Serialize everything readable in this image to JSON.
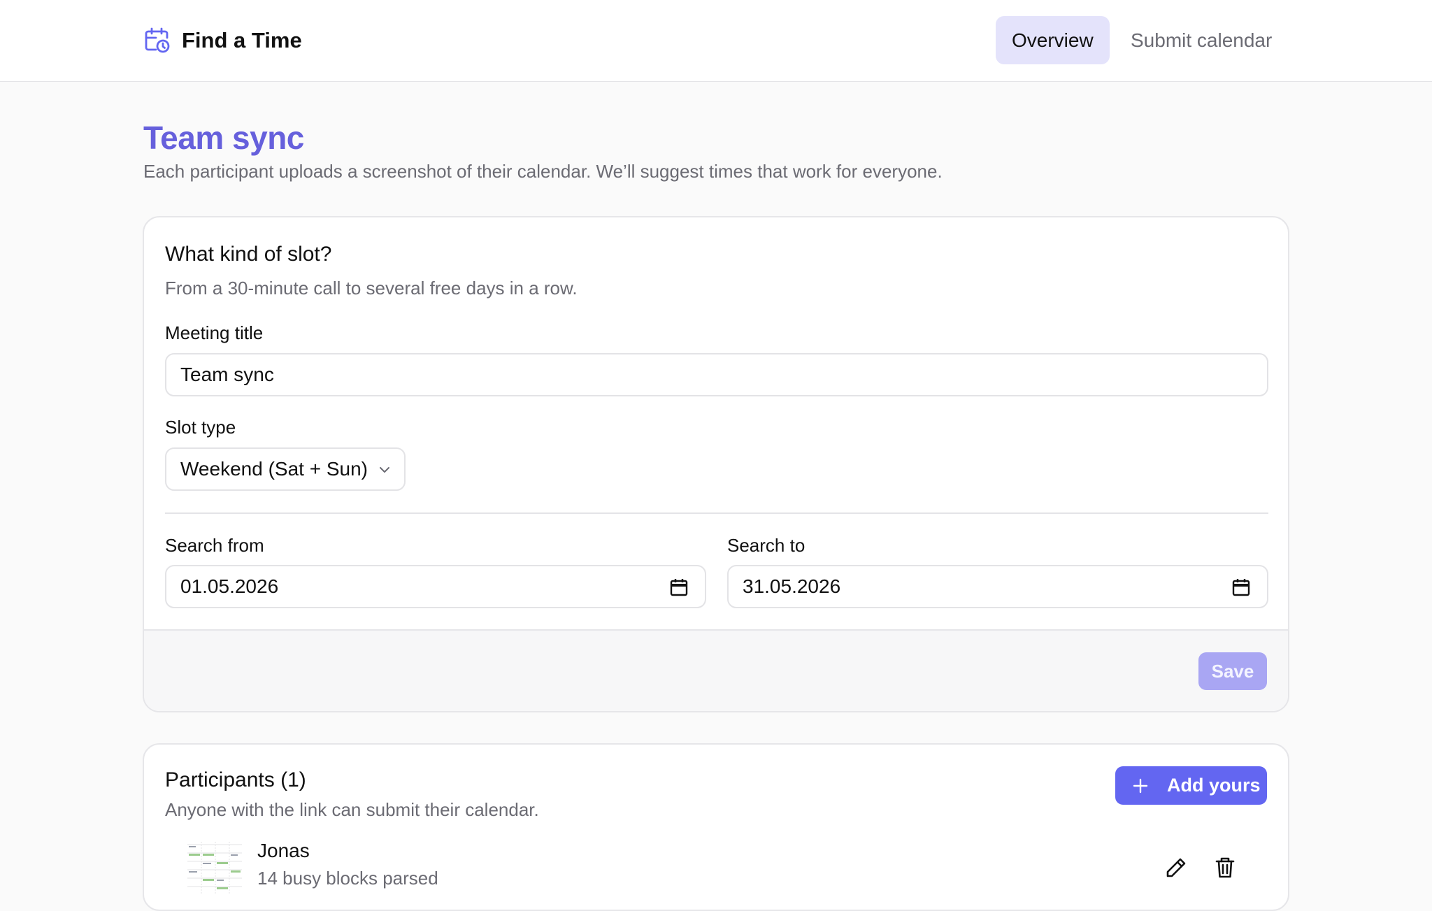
{
  "header": {
    "app_title": "Find a Time",
    "brand_icon": "calendar-clock-icon",
    "tabs": [
      {
        "label": "Overview",
        "active": true
      },
      {
        "label": "Submit calendar",
        "active": false
      }
    ]
  },
  "page": {
    "title": "Team sync",
    "subtitle": "Each participant uploads a screenshot of their calendar. We’ll suggest times that work for everyone."
  },
  "slot_card": {
    "heading": "What kind of slot?",
    "description": "From a 30-minute call to several free days in a row.",
    "meeting_title_label": "Meeting title",
    "meeting_title_value": "Team sync",
    "slot_type_label": "Slot type",
    "slot_type_value": "Weekend (Sat + Sun)",
    "search_from_label": "Search from",
    "search_from_value": "01.05.2026",
    "search_to_label": "Search to",
    "search_to_value": "31.05.2026",
    "save_label": "Save"
  },
  "participants_card": {
    "heading": "Participants (1)",
    "description": "Anyone with the link can submit their calendar.",
    "add_label": "Add yours",
    "participants": [
      {
        "name": "Jonas",
        "status": "14 busy blocks parsed"
      }
    ]
  },
  "colors": {
    "accent": "#6366f1",
    "title": "#6660dc",
    "active_tab_bg": "#e4e3fb",
    "save_disabled": "#a9a6f3"
  }
}
